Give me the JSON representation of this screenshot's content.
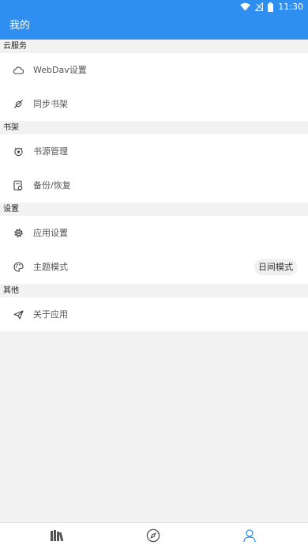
{
  "status_bar": {
    "time": "11:30"
  },
  "app_bar": {
    "title": "我的"
  },
  "sections": [
    {
      "header": "云服务",
      "items": [
        {
          "label": "WebDav设置",
          "icon": "cloud-icon"
        },
        {
          "label": "同步书架",
          "icon": "sync-icon"
        }
      ]
    },
    {
      "header": "书架",
      "items": [
        {
          "label": "书源管理",
          "icon": "book-source-icon"
        },
        {
          "label": "备份/恢复",
          "icon": "backup-icon"
        }
      ]
    },
    {
      "header": "设置",
      "items": [
        {
          "label": "应用设置",
          "icon": "gear-icon"
        },
        {
          "label": "主题模式",
          "icon": "palette-icon",
          "value": "日间模式"
        }
      ]
    },
    {
      "header": "其他",
      "items": [
        {
          "label": "关于应用",
          "icon": "send-icon"
        }
      ]
    }
  ],
  "bottom_nav": [
    {
      "icon": "bookshelf-icon",
      "active": false
    },
    {
      "icon": "compass-icon",
      "active": false
    },
    {
      "icon": "profile-icon",
      "active": true
    }
  ],
  "colors": {
    "primary": "#2f8ff0",
    "background": "#f2f2f2",
    "icon": "#555555"
  }
}
